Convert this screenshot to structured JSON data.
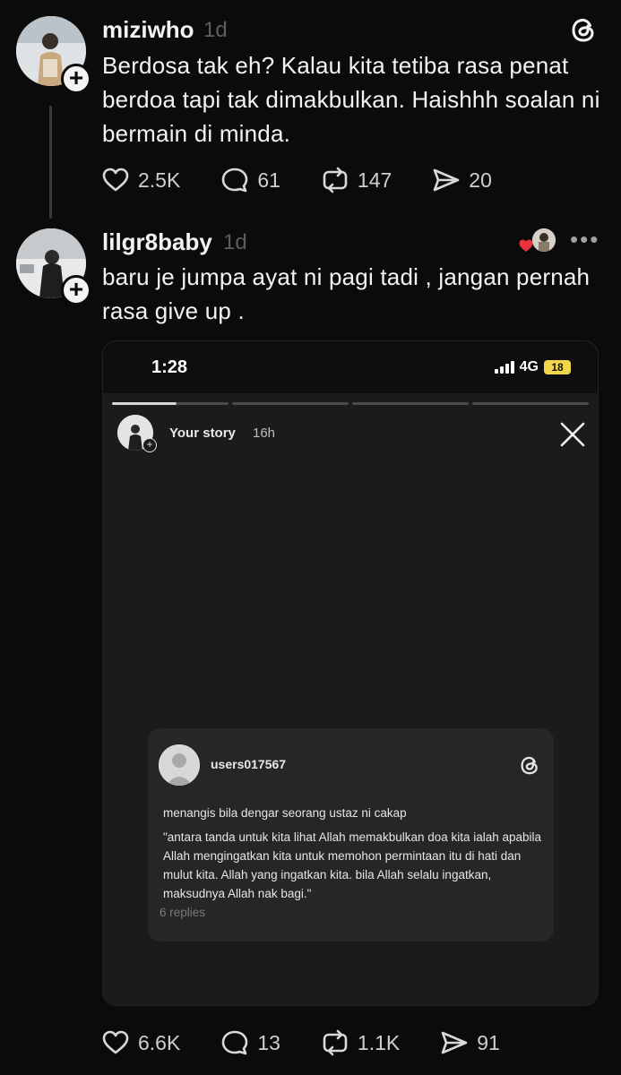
{
  "post1": {
    "username": "miziwho",
    "time": "1d",
    "text": "Berdosa tak eh? Kalau kita tetiba rasa penat berdoa tapi tak dimakbulkan. Haishhh soalan ni bermain di minda.",
    "likes": "2.5K",
    "comments": "61",
    "reposts": "147",
    "shares": "20"
  },
  "post2": {
    "username": "lilgr8baby",
    "time": "1d",
    "text": "baru je jumpa ayat ni pagi tadi , jangan pernah rasa give up .",
    "likes": "6.6K",
    "comments": "13",
    "reposts": "1.1K",
    "shares": "91",
    "more_icon": "•••"
  },
  "embed": {
    "status_time": "1:28",
    "network": "4G",
    "battery": "18",
    "story_label": "Your story",
    "story_time": "16h",
    "card": {
      "username": "users017567",
      "line1": "menangis bila dengar seorang ustaz ni cakap",
      "quote": "\"antara tanda untuk kita lihat Allah memakbulkan doa kita ialah apabila Allah mengingatkan kita untuk memohon permintaan itu di hati dan mulut kita. Allah yang ingatkan kita. bila Allah selalu ingatkan, maksudnya Allah nak bagi.\"",
      "replies": "6 replies"
    }
  },
  "icons": {
    "like": "heart-icon",
    "comment": "comment-icon",
    "repost": "repost-icon",
    "share": "share-icon",
    "brand": "threads-logo-icon",
    "close": "close-icon"
  },
  "colors": {
    "background": "#0b0b0b",
    "text": "#f3f3f3",
    "muted": "#5d5d5d",
    "heart": "#e8323c"
  }
}
